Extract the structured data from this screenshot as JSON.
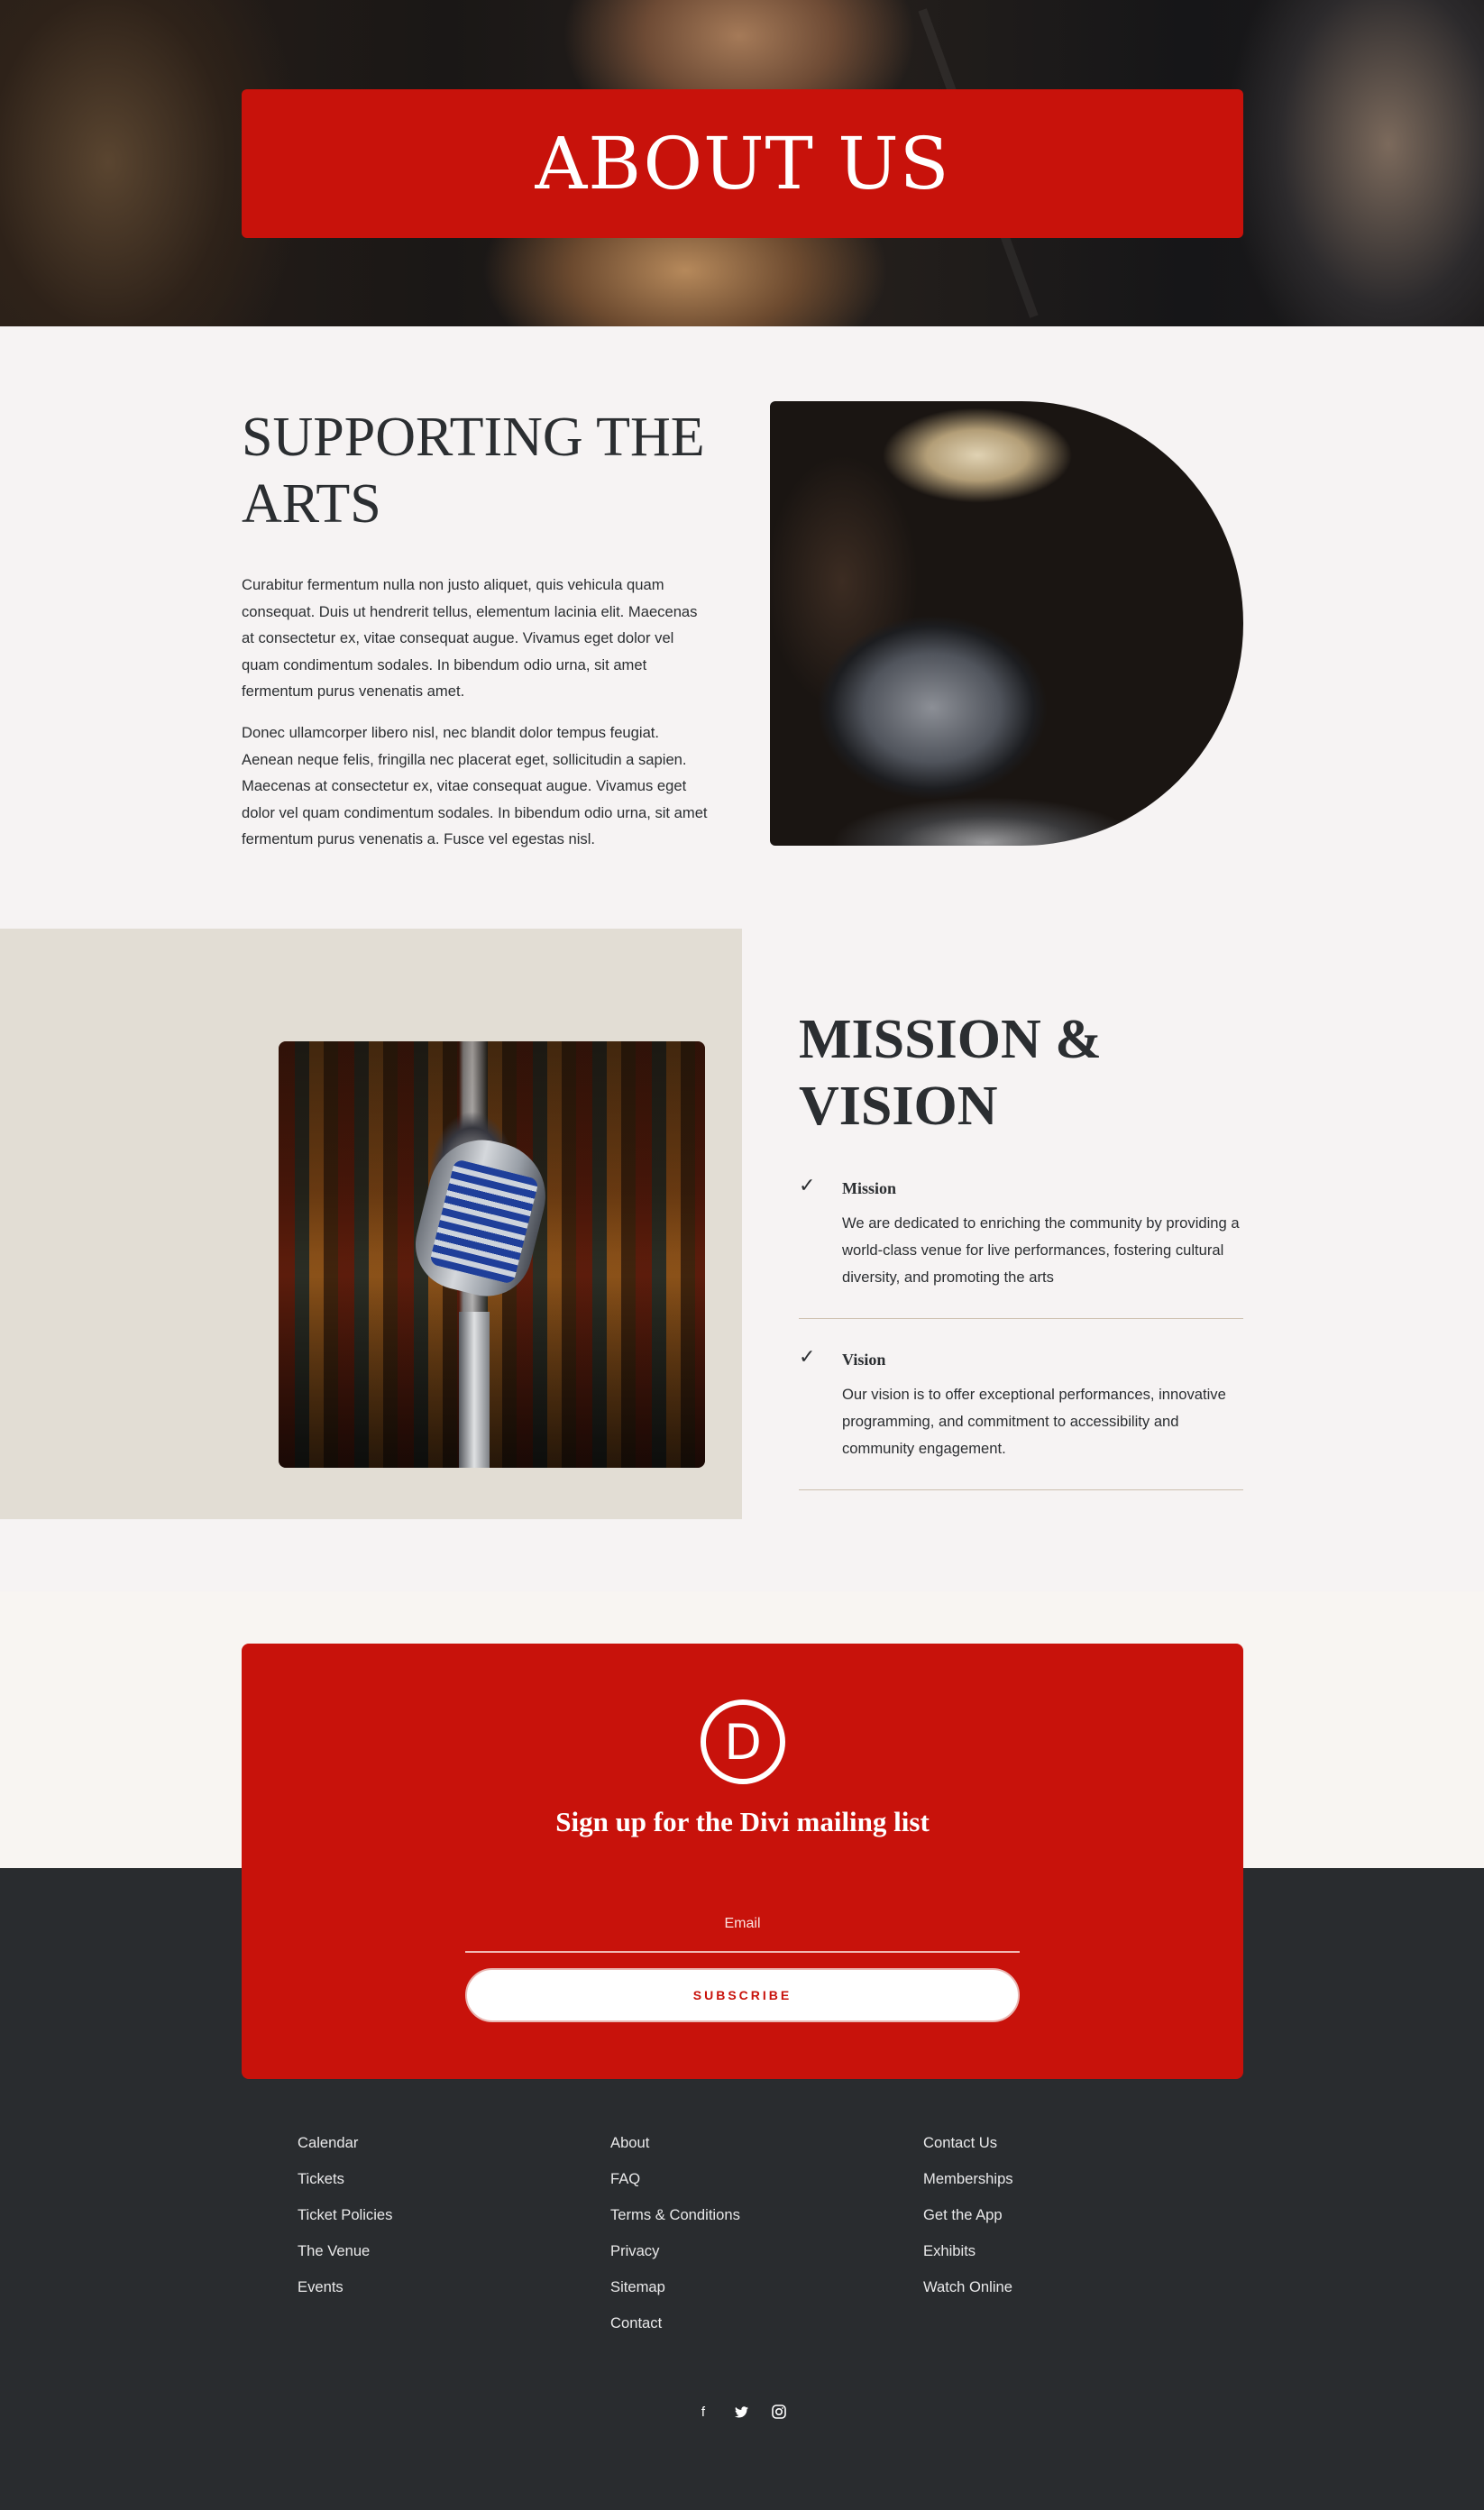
{
  "hero": {
    "title": "ABOUT US"
  },
  "supporting": {
    "title_line1": "SUPPORTING THE",
    "title_line2": "ARTS",
    "paragraph1": "Curabitur fermentum nulla non justo aliquet, quis vehicula quam consequat. Duis ut hendrerit tellus, elementum lacinia elit. Maecenas at consectetur ex, vitae consequat augue. Vivamus eget dolor vel quam condimentum sodales. In bibendum odio urna, sit amet fermentum purus venenatis amet.",
    "paragraph2": "Donec ullamcorper libero nisl, nec blandit dolor tempus feugiat. Aenean neque felis, fringilla nec placerat eget, sollicitudin a sapien. Maecenas at consectetur ex, vitae consequat augue. Vivamus eget dolor vel quam condimentum sodales. In bibendum odio urna, sit amet fermentum purus venenatis a. Fusce vel egestas nisl."
  },
  "mission": {
    "title_line1": "MISSION &",
    "title_line2": "VISION",
    "items": [
      {
        "heading": "Mission",
        "body": "We are dedicated to enriching the community by providing a world-class venue for live performances, fostering cultural diversity, and promoting the arts"
      },
      {
        "heading": "Vision",
        "body": "Our vision is to offer exceptional performances, innovative programming, and commitment to accessibility and community engagement."
      }
    ]
  },
  "newsletter": {
    "logo_letter": "D",
    "title": "Sign up for the Divi mailing list",
    "email_placeholder": "Email",
    "subscribe_label": "SUBSCRIBE"
  },
  "footer": {
    "col1": [
      "Calendar",
      "Tickets",
      "Ticket Policies",
      "The Venue",
      "Events"
    ],
    "col2": [
      "About",
      "FAQ",
      "Terms & Conditions",
      "Privacy",
      "Sitemap",
      "Contact"
    ],
    "col3": [
      "Contact Us",
      "Memberships",
      "Get the App",
      "Exhibits",
      "Watch Online"
    ],
    "social": [
      {
        "icon": "facebook-icon",
        "glyph": "f"
      },
      {
        "icon": "twitter-icon",
        "glyph": "🐦"
      },
      {
        "icon": "instagram-icon",
        "glyph": "◎"
      }
    ]
  },
  "colors": {
    "brand_red": "#c8120b",
    "dark": "#292c2f",
    "beige": "#e2ddd4"
  }
}
